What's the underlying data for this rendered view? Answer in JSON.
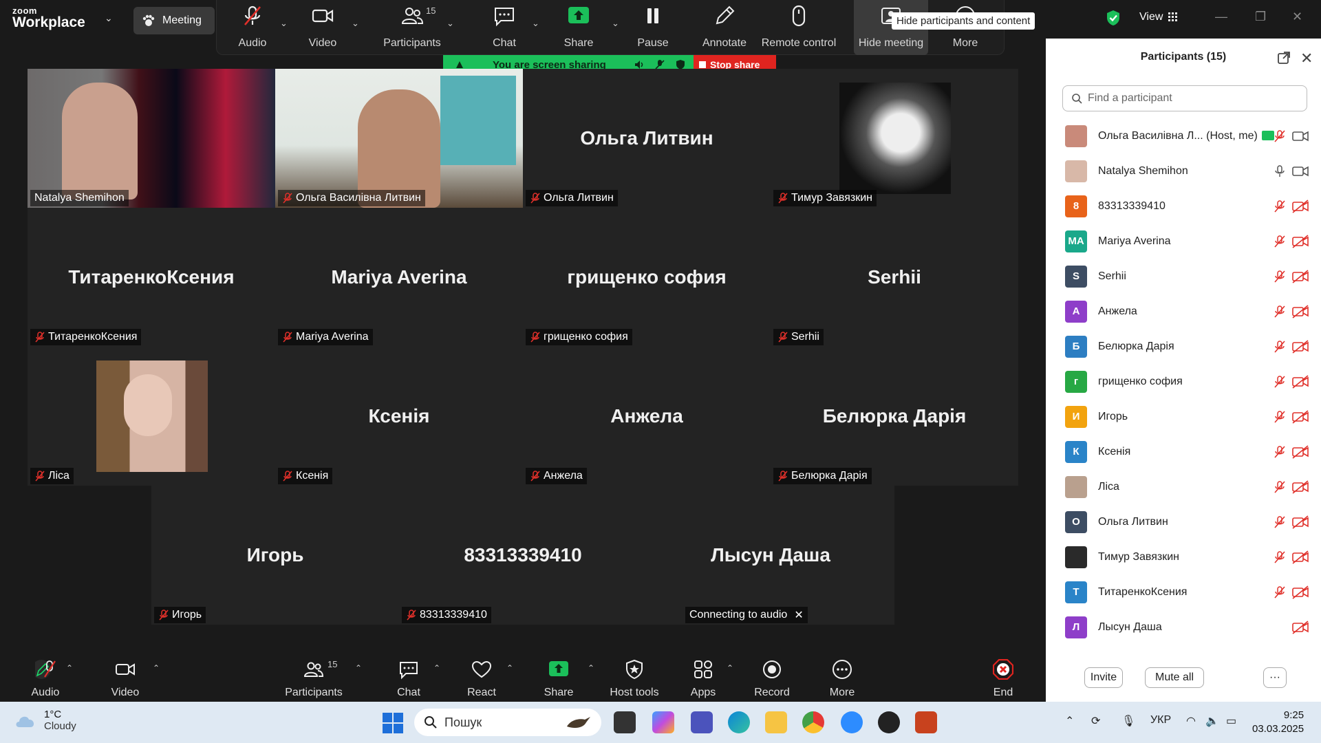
{
  "titlebar": {
    "logo_line1": "zoom",
    "logo_line2": "Workplace",
    "meeting_label": "Meeting",
    "view_label": "View"
  },
  "share_toolbar": {
    "items": [
      {
        "label": "Audio"
      },
      {
        "label": "Video"
      },
      {
        "label": "Participants",
        "badge": "15"
      },
      {
        "label": "Chat"
      },
      {
        "label": "Share"
      },
      {
        "label": "Pause"
      },
      {
        "label": "Annotate"
      },
      {
        "label": "Remote control"
      },
      {
        "label": "Hide meeting"
      },
      {
        "label": "More"
      }
    ],
    "tooltip": "Hide participants and content"
  },
  "share_banner": {
    "text": "You are screen sharing",
    "stop_label": "Stop share"
  },
  "gallery": {
    "tiles": [
      {
        "tag": "Natalya Shemihon",
        "big": ""
      },
      {
        "tag": "Ольга Василівна Литвин",
        "big": ""
      },
      {
        "tag": "Ольга Литвин",
        "big": "Ольга Литвин"
      },
      {
        "tag": "Тимур Завязкин",
        "big": ""
      },
      {
        "tag": "ТитаренкоКсения",
        "big": "ТитаренкоКсения"
      },
      {
        "tag": "Mariya Averina",
        "big": "Mariya Averina"
      },
      {
        "tag": "грищенко софия",
        "big": "грищенко софия"
      },
      {
        "tag": "Serhii",
        "big": "Serhii"
      },
      {
        "tag": "Ліса",
        "big": ""
      },
      {
        "tag": "Ксенія",
        "big": "Ксенія"
      },
      {
        "tag": "Анжела",
        "big": "Анжела"
      },
      {
        "tag": "Белюрка Дарія",
        "big": "Белюрка Дарія"
      },
      {
        "tag": "Игорь",
        "big": "Игорь"
      },
      {
        "tag": "83313339410",
        "big": "83313339410"
      },
      {
        "tag": "Connecting to audio",
        "big": "Лысун Даша"
      }
    ]
  },
  "participants_panel": {
    "title": "Participants (15)",
    "search_placeholder": "Find a participant",
    "list": [
      {
        "name": "Ольга Василівна Л... (Host, me)",
        "initial": "",
        "color": "#c98a7a"
      },
      {
        "name": "Natalya Shemihon",
        "initial": "",
        "color": "#d8b8a8"
      },
      {
        "name": "83313339410",
        "initial": "8",
        "color": "#e8631a"
      },
      {
        "name": "Mariya Averina",
        "initial": "MA",
        "color": "#1aa88a"
      },
      {
        "name": "Serhii",
        "initial": "S",
        "color": "#3d4d63"
      },
      {
        "name": "Анжела",
        "initial": "А",
        "color": "#8e3ec9"
      },
      {
        "name": "Белюрка Дарія",
        "initial": "Б",
        "color": "#2d7ec2"
      },
      {
        "name": "грищенко софия",
        "initial": "г",
        "color": "#27a844"
      },
      {
        "name": "Игорь",
        "initial": "И",
        "color": "#f2a30f"
      },
      {
        "name": "Ксенія",
        "initial": "К",
        "color": "#2a84c8"
      },
      {
        "name": "Ліса",
        "initial": "",
        "color": "#b9a08e"
      },
      {
        "name": "Ольга Литвин",
        "initial": "О",
        "color": "#3d4d63"
      },
      {
        "name": "Тимур Завязкин",
        "initial": "",
        "color": "#2a2a2a"
      },
      {
        "name": "ТитаренкоКсения",
        "initial": "Т",
        "color": "#2a84c8"
      },
      {
        "name": "Лысун Даша",
        "initial": "Л",
        "color": "#8e3ec9"
      }
    ],
    "invite_label": "Invite",
    "mute_all_label": "Mute all",
    "more_label": "···"
  },
  "bottom_toolbar": {
    "items": [
      {
        "label": "Audio"
      },
      {
        "label": "Video"
      },
      {
        "label": "Participants",
        "badge": "15"
      },
      {
        "label": "Chat"
      },
      {
        "label": "React"
      },
      {
        "label": "Share"
      },
      {
        "label": "Host tools"
      },
      {
        "label": "Apps"
      },
      {
        "label": "Record"
      },
      {
        "label": "More"
      },
      {
        "label": "End"
      }
    ]
  },
  "taskbar": {
    "weather_temp": "1°C",
    "weather_desc": "Cloudy",
    "search_placeholder": "Пошук",
    "lang": "УКР",
    "time": "9:25",
    "date": "03.03.2025"
  },
  "colors": {
    "accent_green": "#1bbf5a",
    "stop_red": "#e0241f",
    "muted_red": "#e0302a"
  }
}
